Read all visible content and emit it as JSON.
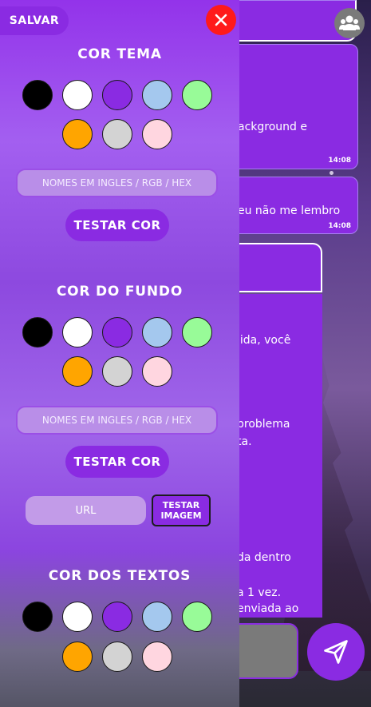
{
  "panel": {
    "save_label": "SALVAR",
    "sections": [
      {
        "title": "COR TEMA",
        "swatches": [
          "#000000",
          "#ffffff",
          "#8a2be2",
          "#a4c8ee",
          "#98fb98",
          "#ffa500",
          "#d3d3d3",
          "#ffd6e0"
        ],
        "input_placeholder": "NOMES EM INGLES / RGB / HEX",
        "test_label": "TESTAR COR"
      },
      {
        "title": "COR DO FUNDO",
        "swatches": [
          "#000000",
          "#ffffff",
          "#8a2be2",
          "#a4c8ee",
          "#98fb98",
          "#ffa500",
          "#d3d3d3",
          "#ffd6e0"
        ],
        "input_placeholder": "NOMES EM INGLES / RGB / HEX",
        "test_label": "TESTAR COR",
        "url_placeholder": "URL",
        "test_image_label_line1": "TESTAR",
        "test_image_label_line2": "IMAGEM"
      },
      {
        "title": "COR DOS TEXTOS",
        "swatches": [
          "#000000",
          "#ffffff",
          "#8a2be2",
          "#a4c8ee",
          "#98fb98",
          "#ffa500",
          "#d3d3d3",
          "#ffd6e0"
        ]
      }
    ]
  },
  "chat": {
    "messages": [
      {
        "text": "ackground e",
        "time": "14:08"
      },
      {
        "text": "eu não me lembro",
        "time": "14:08"
      },
      {
        "text": "lida, você"
      },
      {
        "text": "problema"
      },
      {
        "text": "ta."
      },
      {
        "text": "da dentro"
      },
      {
        "text": "a 1 vez."
      },
      {
        "text": "enviada ao"
      }
    ]
  },
  "colors": {
    "accent": "#8a2be2",
    "close": "#ff1a1a"
  }
}
